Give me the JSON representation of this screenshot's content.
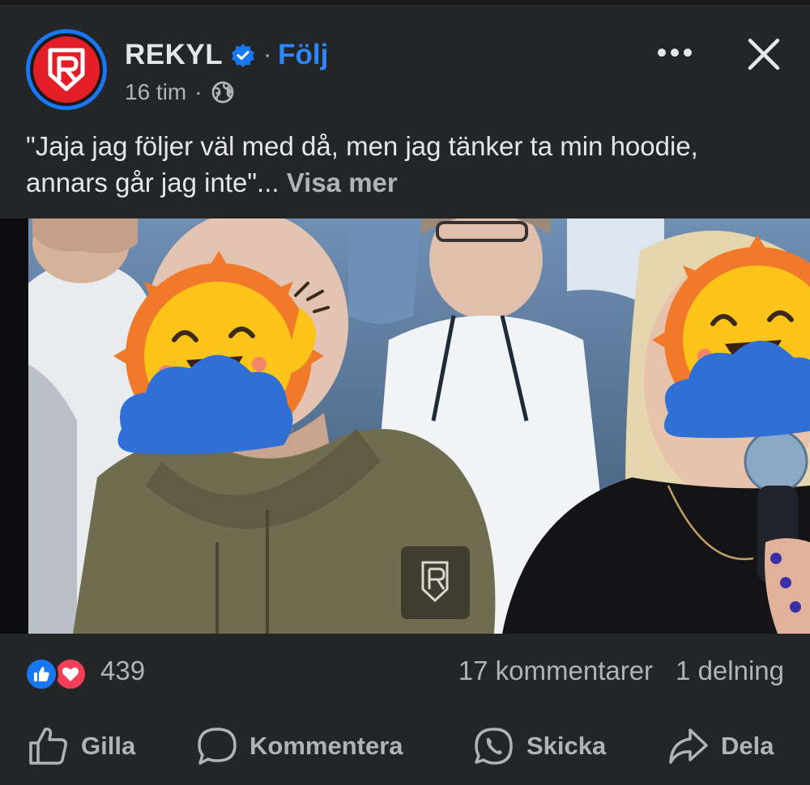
{
  "post": {
    "author": "REKYL",
    "follow_label": "Följ",
    "separator": "·",
    "timestamp": "16 tim",
    "text": "\"Jaja jag följer väl med då, men jag tänker ta min hoodie, annars går jag inte\"...",
    "see_more": "Visa mer"
  },
  "icons": {
    "avatar": "rekyl-logo",
    "verified": "verified-badge-icon",
    "privacy": "globe-icon",
    "more": "more-icon",
    "close": "close-icon"
  },
  "stats": {
    "reaction_count": "439",
    "comments": "17 kommentarer",
    "shares": "1 delning"
  },
  "actions": {
    "like": "Gilla",
    "comment": "Kommentera",
    "send": "Skicka",
    "share": "Dela"
  },
  "colors": {
    "background": "#242526",
    "accent": "#2d88ff",
    "brand_red": "#e41e26",
    "like_blue": "#1877f2",
    "love_red": "#f33e58"
  }
}
